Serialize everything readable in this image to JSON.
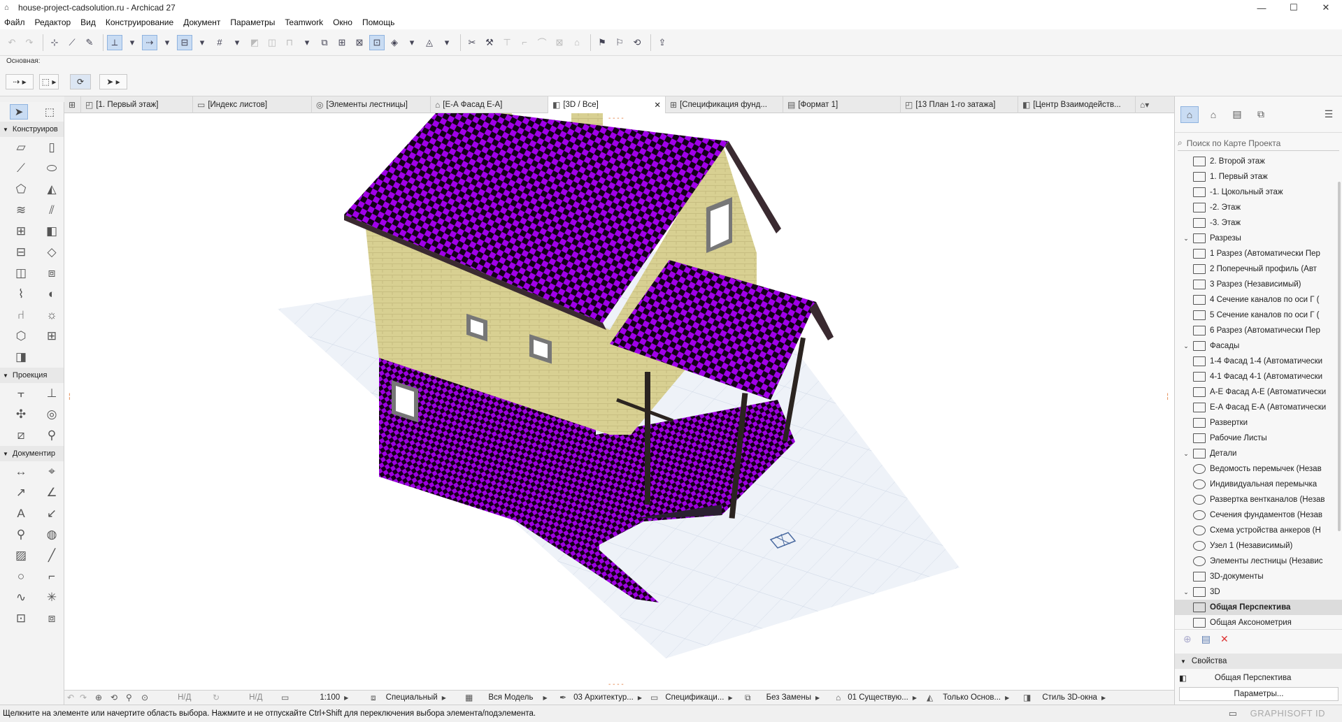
{
  "window": {
    "title": "house-project-cadsolution.ru - Archicad 27",
    "controls": [
      "—",
      "☐",
      "✕"
    ]
  },
  "menu": [
    "Файл",
    "Редактор",
    "Вид",
    "Конструирование",
    "Документ",
    "Параметры",
    "Teamwork",
    "Окно",
    "Помощь"
  ],
  "infobox": {
    "label": "Основная:"
  },
  "toolbox": {
    "sections": [
      {
        "label": "Конструиров"
      },
      {
        "label": "Проекция"
      },
      {
        "label": "Документир"
      }
    ]
  },
  "tabs": [
    {
      "label": "[1. Первый этаж]",
      "icon": "floor-plan-icon"
    },
    {
      "label": "[Индекс листов]",
      "icon": "sheet-index-icon"
    },
    {
      "label": "[Элементы лестницы]",
      "icon": "detail-icon"
    },
    {
      "label": "[Е-А Фасад Е-А]",
      "icon": "elevation-icon"
    },
    {
      "label": "[3D / Все]",
      "icon": "3d-icon",
      "active": true,
      "close": "✕"
    },
    {
      "label": "[Спецификация фунд...",
      "icon": "schedule-icon"
    },
    {
      "label": "[Формат 1]",
      "icon": "layout-icon"
    },
    {
      "label": "[13 План 1-го затажа]",
      "icon": "drawing-icon"
    },
    {
      "label": "[Центр Взаимодейств...",
      "icon": "bim-center-icon"
    }
  ],
  "navigator": {
    "search_placeholder": "Поиск по Карте Проекта",
    "items": [
      {
        "label": "2. Второй этаж",
        "level": 2
      },
      {
        "label": "1. Первый этаж",
        "level": 2
      },
      {
        "label": "-1. Цокольный этаж",
        "level": 2
      },
      {
        "label": "-2. Этаж",
        "level": 2
      },
      {
        "label": "-3. Этаж",
        "level": 2
      },
      {
        "label": "Разрезы",
        "level": 1,
        "toggle": "⌄"
      },
      {
        "label": "1 Разрез (Автоматически Пер",
        "level": 2
      },
      {
        "label": "2 Поперечный профиль (Авт",
        "level": 2
      },
      {
        "label": "3 Разрез (Независимый)",
        "level": 2
      },
      {
        "label": "4 Сечение каналов по оси Г (",
        "level": 2
      },
      {
        "label": "5 Сечение каналов по оси Г (",
        "level": 2
      },
      {
        "label": "6 Разрез (Автоматически Пер",
        "level": 2
      },
      {
        "label": "Фасады",
        "level": 1,
        "toggle": "⌄"
      },
      {
        "label": "1-4 Фасад 1-4 (Автоматически",
        "level": 2
      },
      {
        "label": "4-1 Фасад 4-1 (Автоматически",
        "level": 2
      },
      {
        "label": "А-Е Фасад А-Е (Автоматически",
        "level": 2
      },
      {
        "label": "Е-А Фасад Е-А (Автоматически",
        "level": 2
      },
      {
        "label": "Развертки",
        "level": 1
      },
      {
        "label": "Рабочие Листы",
        "level": 1
      },
      {
        "label": "Детали",
        "level": 1,
        "toggle": "⌄"
      },
      {
        "label": "Ведомость перемычек (Незав",
        "level": 2
      },
      {
        "label": "Индивидуальная перемычка",
        "level": 2
      },
      {
        "label": "Развертка вентканалов (Незав",
        "level": 2
      },
      {
        "label": "Сечения фундаментов (Незав",
        "level": 2
      },
      {
        "label": "Схема устройства анкеров (Н",
        "level": 2
      },
      {
        "label": "Узел 1 (Независимый)",
        "level": 2
      },
      {
        "label": "Элементы лестницы (Независ",
        "level": 2
      },
      {
        "label": "3D-документы",
        "level": 1
      },
      {
        "label": "3D",
        "level": 1,
        "toggle": "⌄"
      },
      {
        "label": "Общая Перспектива",
        "level": 2,
        "selected": true
      },
      {
        "label": "Общая Аксонометрия",
        "level": 2
      }
    ]
  },
  "properties": {
    "header": "Свойства",
    "value": "Общая Перспектива",
    "button": "Параметры..."
  },
  "quickbar": {
    "zoom1": "Н/Д",
    "zoom2": "Н/Д",
    "scale": "1:100",
    "structure": "Специальный",
    "layers": "Вся Модель",
    "pen": "03 Архитектур...",
    "model_view": "Спецификаци...",
    "override": "Без Замены",
    "renovation": "01 Существую...",
    "partial": "Только Основ...",
    "style3d": "Стиль 3D-окна"
  },
  "status": {
    "hint": "Щелкните на элементе или начертите область выбора. Нажмите и не отпускайте Ctrl+Shift для переключения выбора элемента/подэлемента.",
    "brand": "GRAPHISOFT ID"
  },
  "colors": {
    "roof_a": "#a000e8",
    "roof_b": "#140018",
    "wall": "#d8d092",
    "accent": "#8fb3df"
  }
}
